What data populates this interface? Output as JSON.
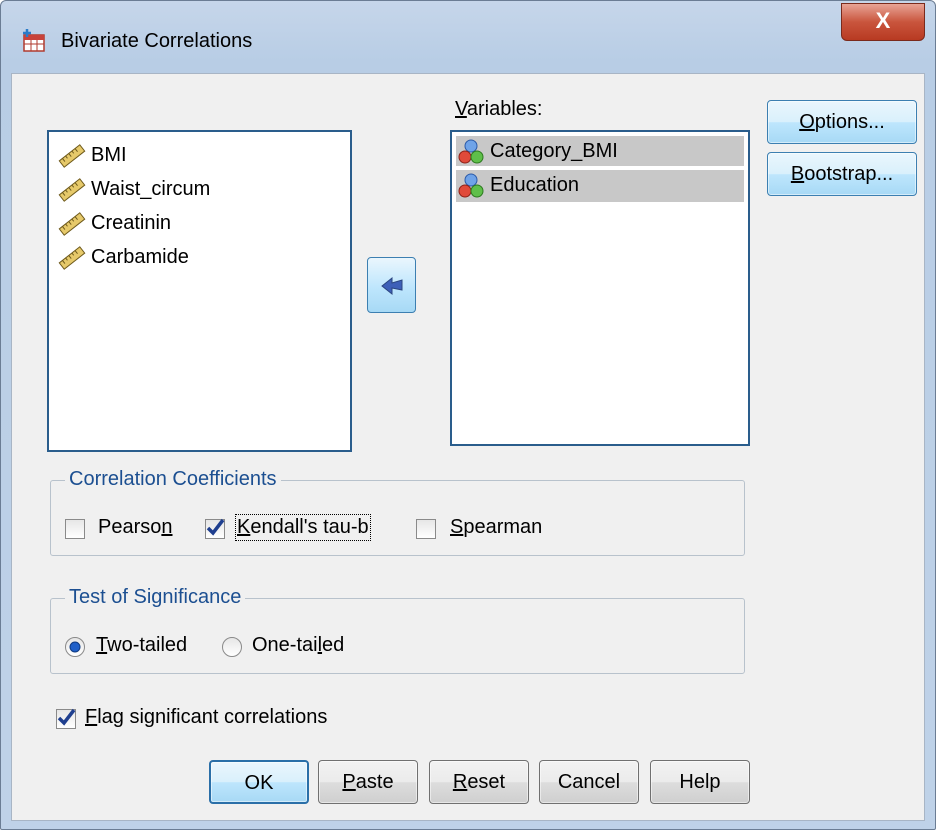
{
  "window": {
    "title": "Bivariate Correlations",
    "close_glyph": "X"
  },
  "source_list": {
    "items": [
      {
        "label": "BMI",
        "icon": "scale-ruler-icon"
      },
      {
        "label": "Waist_circum",
        "icon": "scale-ruler-icon"
      },
      {
        "label": "Creatinin",
        "icon": "scale-ruler-icon"
      },
      {
        "label": "Carbamide",
        "icon": "scale-ruler-icon"
      }
    ]
  },
  "variables": {
    "label_first": "V",
    "label_rest": "ariables:",
    "items": [
      {
        "label": "Category_BMI",
        "icon": "nominal-icon",
        "selected": true
      },
      {
        "label": "Education",
        "icon": "nominal-icon",
        "selected": true
      }
    ]
  },
  "side_buttons": {
    "options_first": "O",
    "options_rest": "ptions...",
    "bootstrap_first": "B",
    "bootstrap_rest": "ootstrap..."
  },
  "correlation": {
    "title": "Correlation Coefficients",
    "pearson_a": "Pearso",
    "pearson_u": "n",
    "pearson_checked": false,
    "kendall_a": "",
    "kendall_u": "K",
    "kendall_b": "endall's tau-b",
    "kendall_checked": true,
    "spearman_u": "S",
    "spearman_b": "pearman",
    "spearman_checked": false
  },
  "significance": {
    "title": "Test of Significance",
    "two_u": "T",
    "two_b": "wo-tailed",
    "two_selected": true,
    "one_a": "One-tai",
    "one_u": "l",
    "one_b": "ed",
    "one_selected": false
  },
  "flag": {
    "u": "F",
    "b": "lag significant correlations",
    "checked": true
  },
  "bottom_buttons": {
    "ok": "OK",
    "paste_u": "P",
    "paste_b": "aste",
    "reset_u": "R",
    "reset_b": "eset",
    "cancel": "Cancel",
    "help": "Help"
  },
  "colors": {
    "accent": "#1c4f91",
    "check": "#1f3f8f",
    "list_border": "#2a5d8c"
  }
}
